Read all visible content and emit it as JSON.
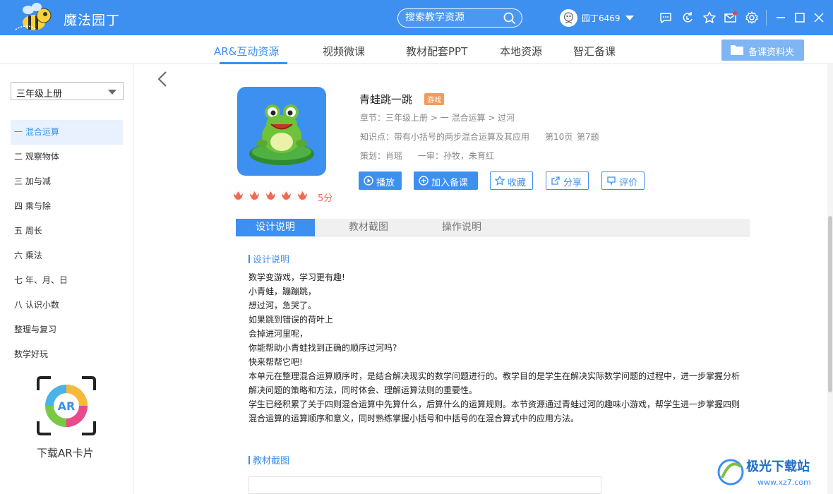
{
  "app": {
    "title": "魔法园丁"
  },
  "search": {
    "placeholder": "搜索教学资源"
  },
  "user": {
    "name": "园丁6469"
  },
  "nav": {
    "tabs": [
      {
        "label": "AR&互动资源"
      },
      {
        "label": "视频微课"
      },
      {
        "label": "教材配套PPT"
      },
      {
        "label": "本地资源"
      },
      {
        "label": "智汇备课"
      }
    ],
    "prep_button": "备课资料夹"
  },
  "sidebar": {
    "grade": "三年级上册",
    "chapters": [
      {
        "label": "一 混合运算"
      },
      {
        "label": "二 观察物体"
      },
      {
        "label": "三 加与减"
      },
      {
        "label": "四 乘与除"
      },
      {
        "label": "五 周长"
      },
      {
        "label": "六 乘法"
      },
      {
        "label": "七 年、月、日"
      },
      {
        "label": "八 认识小数"
      },
      {
        "label": "整理与复习"
      },
      {
        "label": "数学好玩"
      }
    ],
    "ar_card_label": "下载AR卡片",
    "ar_card_text": "AR"
  },
  "resource": {
    "title": "青蛙跳一跳",
    "badge": "游戏",
    "chapter": "章节：三年级上册 > 一 混合运算 > 过河",
    "knowledge": "知识点：带有小括号的两步混合运算及其应用",
    "page": "第10页",
    "question": "第7题",
    "planner": "策划：肖瑶",
    "reviewer": "一审：孙牧，朱育红",
    "score": "5分",
    "rating": 5
  },
  "actions": {
    "play": "播放",
    "add": "加入备课",
    "favorite": "收藏",
    "share": "分享",
    "review": "评价"
  },
  "detail_tabs": [
    {
      "label": "设计说明"
    },
    {
      "label": "教材截图"
    },
    {
      "label": "操作说明"
    }
  ],
  "design": {
    "heading": "设计说明",
    "lines": [
      "数学变游戏，学习更有趣!",
      "小青蛙，蹦蹦跳，",
      "想过河，急哭了。",
      "如果跳到错误的荷叶上",
      "会掉进河里呢，",
      "你能帮助小青蛙找到正确的顺序过河吗?",
      "快来帮帮它吧!",
      "本单元在整理混合运算顺序时，是结合解决现实的数学问题进行的。教学目的是学生在解决实际数学问题的过程中，进一步掌握分析",
      "解决问题的策略和方法，同时体会、理解运算法则的重要性。",
      "学生已经积累了关于四则混合运算中先算什么，后算什么的运算规则。本节资源通过青蛙过河的趣味小游戏，帮学生进一步掌握四则",
      "混合运算的运算顺序和意义，同时熟练掌握小括号和中括号的在混合算式中的应用方法。"
    ]
  },
  "screenshot_section": {
    "heading": "教材截图"
  },
  "watermark": {
    "text": "极光下载站",
    "url": "www.xz7.com"
  },
  "colors": {
    "primary": "#3d8ff0",
    "badge": "#f49a5a",
    "score": "#f06b54"
  }
}
